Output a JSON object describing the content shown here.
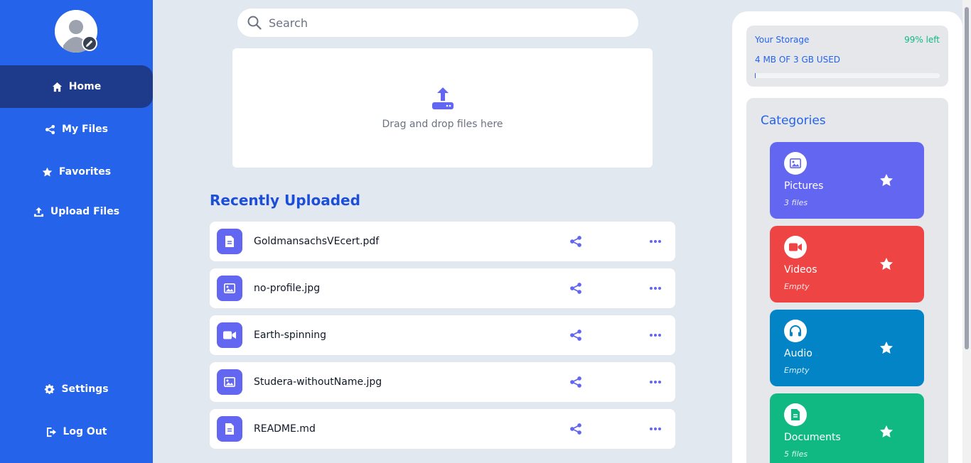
{
  "sidebar": {
    "items": [
      {
        "label": "Home"
      },
      {
        "label": "My Files"
      },
      {
        "label": "Favorites"
      },
      {
        "label": "Upload Files"
      }
    ],
    "bottom": [
      {
        "label": "Settings"
      },
      {
        "label": "Log Out"
      }
    ]
  },
  "search": {
    "placeholder": "Search"
  },
  "dropzone": {
    "text": "Drag and drop files here"
  },
  "recent": {
    "title": "Recently Uploaded",
    "files": [
      {
        "name": "GoldmansachsVEcert.pdf",
        "icon": "document-icon"
      },
      {
        "name": "no-profile.jpg",
        "icon": "image-icon"
      },
      {
        "name": "Earth-spinning",
        "icon": "video-icon"
      },
      {
        "name": "Studera-withoutName.jpg",
        "icon": "image-icon"
      },
      {
        "name": "README.md",
        "icon": "document-icon"
      }
    ]
  },
  "storage": {
    "title": "Your Storage",
    "left": "99% left",
    "used": "4 MB OF 3 GB USED",
    "used_fraction": 0.0013
  },
  "categories": {
    "title": "Categories",
    "items": [
      {
        "name": "Pictures",
        "count": "3 files",
        "color": "#6366f1",
        "icon": "image-icon"
      },
      {
        "name": "Videos",
        "count": "Empty",
        "color": "#ef4444",
        "icon": "video-icon"
      },
      {
        "name": "Audio",
        "count": "Empty",
        "color": "#0284c7",
        "icon": "headphones-icon"
      },
      {
        "name": "Documents",
        "count": "5 files",
        "color": "#10b981",
        "icon": "document-icon"
      }
    ]
  },
  "colors": {
    "sidebar": "#2563eb",
    "sidebar_active": "#1e3a8a",
    "accent": "#6366f1",
    "background": "#e2e8f0"
  }
}
